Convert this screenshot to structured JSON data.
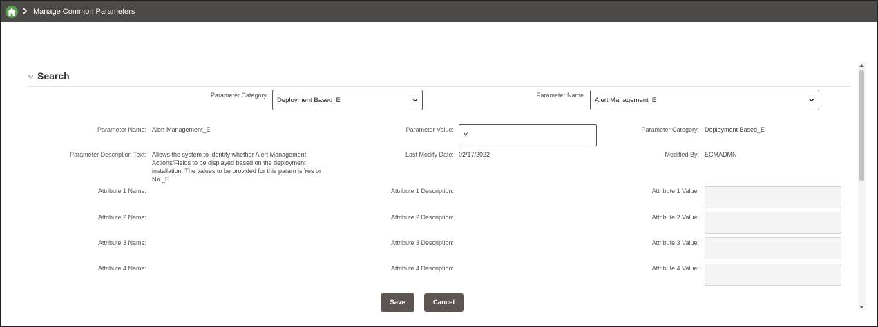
{
  "topbar": {
    "breadcrumb": "Manage Common Parameters",
    "home_icon": "home-icon",
    "separator_icon": "chevron-right-icon"
  },
  "search": {
    "title": "Search",
    "parameter_category_label": "Parameter Category",
    "parameter_category_value": "Deployment Based_E",
    "parameter_name_label": "Parameter Name",
    "parameter_name_value": "Alert Management_E"
  },
  "details": {
    "param_name_label": "Parameter Name:",
    "param_name_value": "Alert Management_E",
    "param_value_label": "Parameter Value:",
    "param_value_value": "Y",
    "param_category_label": "Parameter Category:",
    "param_category_value": "Deployment Based_E",
    "desc_label": "Parameter Description Text:",
    "desc_lines": [
      "Allows the system to identify whether Alert Management",
      "Actions/Fields to be displayed based on the deployment",
      "installation. The values to be provided for this param is Yes or",
      "No._E"
    ],
    "last_modify_label": "Last Modify Date:",
    "last_modify_value": "02/17/2022",
    "modified_by_label": "Modified By:",
    "modified_by_value": "ECMADMN"
  },
  "attributes": [
    {
      "name_label": "Attribute 1 Name:",
      "desc_label": "Attribute 1 Description:",
      "value_label": "Attribute 1 Value:"
    },
    {
      "name_label": "Attribute 2 Name:",
      "desc_label": "Attribute 2 Description:",
      "value_label": "Attribute 2 Value:"
    },
    {
      "name_label": "Attribute 3 Name:",
      "desc_label": "Attribute 3 Description:",
      "value_label": "Attribute 3 Value:"
    },
    {
      "name_label": "Attribute 4 Name:",
      "desc_label": "Attribute 4 Description:",
      "value_label": "Attribute 4 Value:"
    }
  ],
  "buttons": {
    "save": "Save",
    "cancel": "Cancel"
  },
  "colors": {
    "topbar": "#4c4a48",
    "home": "#5e9e54",
    "button": "#5c5551"
  }
}
